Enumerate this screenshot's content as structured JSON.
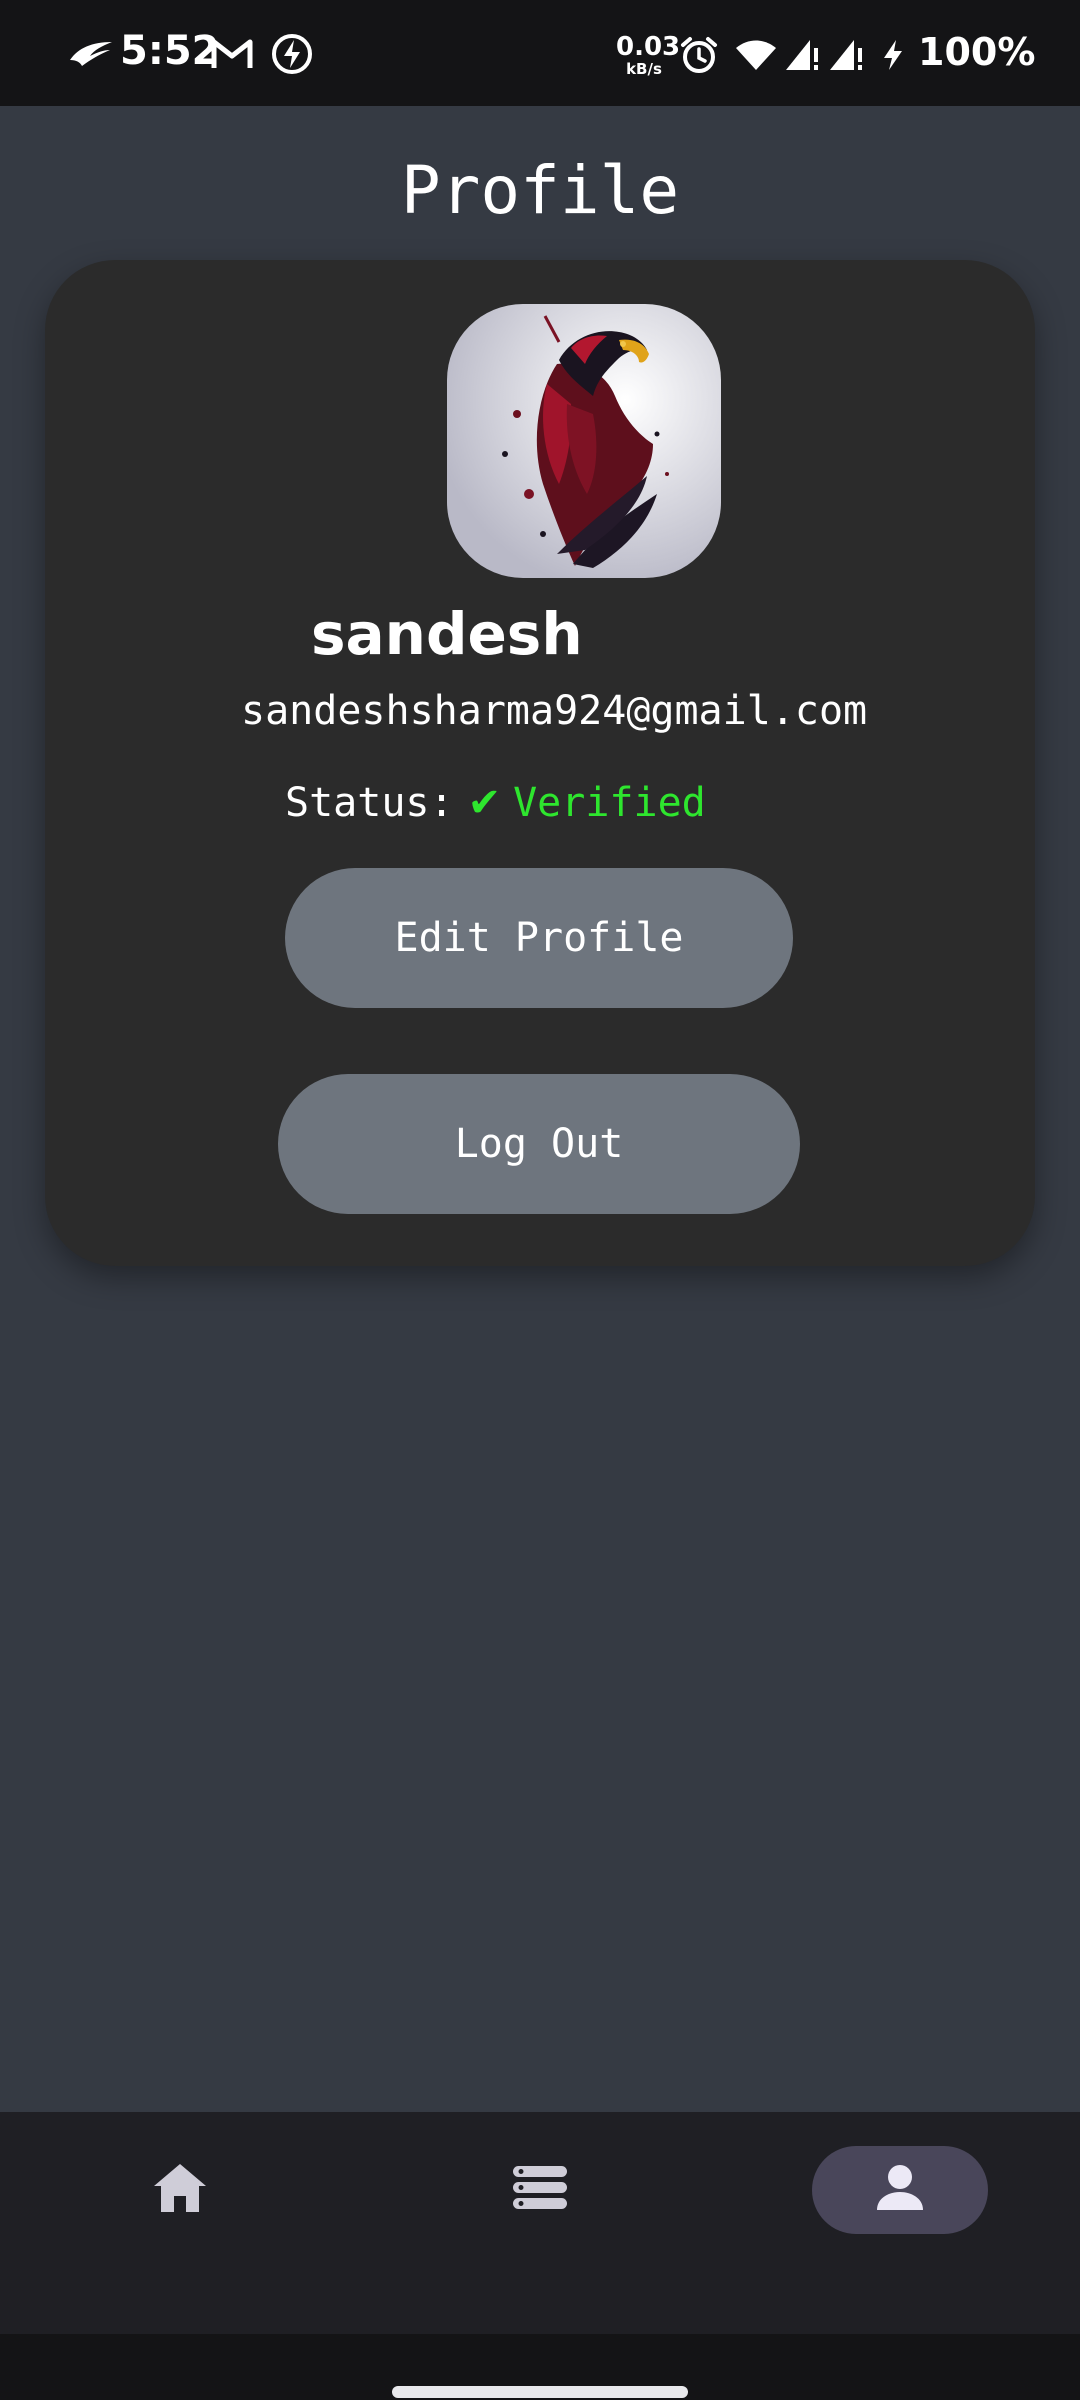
{
  "status_bar": {
    "time": "5:52",
    "speed_value": "0.03",
    "speed_unit": "kB/s",
    "battery": "100%",
    "icons": [
      "rog-logo-icon",
      "gmail-icon",
      "power-icon",
      "alarm-icon",
      "wifi-icon",
      "signal-icon",
      "signal-icon",
      "charging-icon"
    ]
  },
  "header": {
    "title": "Profile"
  },
  "profile": {
    "avatar": "eagle-avatar",
    "username": "sandesh",
    "email": "sandeshsharma924@gmail.com",
    "status_label": "Status:",
    "status_check": "✔",
    "status_value": "Verified"
  },
  "actions": {
    "edit_label": "Edit Profile",
    "logout_label": "Log Out"
  },
  "bottom_nav": {
    "items": [
      {
        "icon": "home-icon",
        "active": false
      },
      {
        "icon": "list-icon",
        "active": false
      },
      {
        "icon": "person-icon",
        "active": true
      }
    ]
  },
  "colors": {
    "background": "#353a43",
    "card": "#2b2b2b",
    "button": "#6e757e",
    "verified": "#2ee62e",
    "nav_active": "#49465a"
  }
}
